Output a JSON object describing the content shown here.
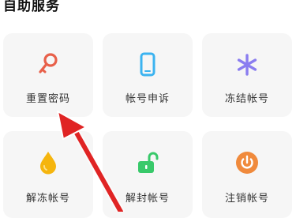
{
  "section": {
    "title": "自助服务"
  },
  "tiles": [
    {
      "label": "重置密码",
      "icon": "key-icon",
      "color": "#e8604a"
    },
    {
      "label": "帐号申诉",
      "icon": "phone-icon",
      "color": "#3bb3f0"
    },
    {
      "label": "冻结帐号",
      "icon": "snowflake-icon",
      "color": "#8a7df0"
    },
    {
      "label": "解冻帐号",
      "icon": "drop-icon",
      "color": "#f5b50e"
    },
    {
      "label": "解封帐号",
      "icon": "unlock-icon",
      "color": "#38c96a"
    },
    {
      "label": "注销帐号",
      "icon": "power-icon",
      "color": "#f08a3c"
    }
  ],
  "annotation": {
    "arrow_color": "#e02424",
    "points_to": "重置密码"
  }
}
